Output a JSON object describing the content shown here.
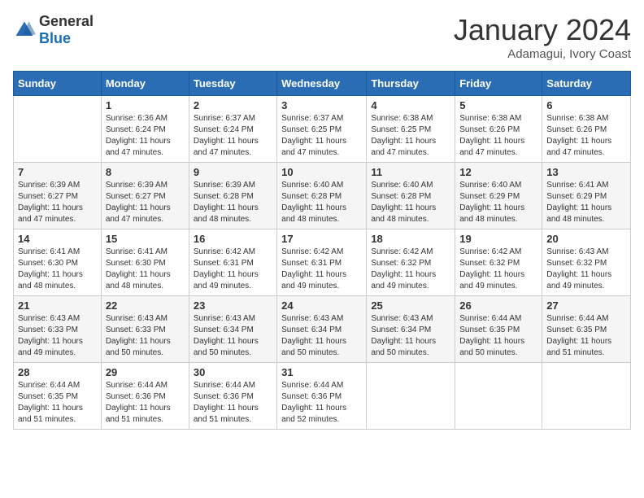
{
  "header": {
    "logo_general": "General",
    "logo_blue": "Blue",
    "month_title": "January 2024",
    "subtitle": "Adamagui, Ivory Coast"
  },
  "weekdays": [
    "Sunday",
    "Monday",
    "Tuesday",
    "Wednesday",
    "Thursday",
    "Friday",
    "Saturday"
  ],
  "weeks": [
    [
      {
        "day": "",
        "info": ""
      },
      {
        "day": "1",
        "info": "Sunrise: 6:36 AM\nSunset: 6:24 PM\nDaylight: 11 hours and 47 minutes."
      },
      {
        "day": "2",
        "info": "Sunrise: 6:37 AM\nSunset: 6:24 PM\nDaylight: 11 hours and 47 minutes."
      },
      {
        "day": "3",
        "info": "Sunrise: 6:37 AM\nSunset: 6:25 PM\nDaylight: 11 hours and 47 minutes."
      },
      {
        "day": "4",
        "info": "Sunrise: 6:38 AM\nSunset: 6:25 PM\nDaylight: 11 hours and 47 minutes."
      },
      {
        "day": "5",
        "info": "Sunrise: 6:38 AM\nSunset: 6:26 PM\nDaylight: 11 hours and 47 minutes."
      },
      {
        "day": "6",
        "info": "Sunrise: 6:38 AM\nSunset: 6:26 PM\nDaylight: 11 hours and 47 minutes."
      }
    ],
    [
      {
        "day": "7",
        "info": "Sunrise: 6:39 AM\nSunset: 6:27 PM\nDaylight: 11 hours and 47 minutes."
      },
      {
        "day": "8",
        "info": "Sunrise: 6:39 AM\nSunset: 6:27 PM\nDaylight: 11 hours and 47 minutes."
      },
      {
        "day": "9",
        "info": "Sunrise: 6:39 AM\nSunset: 6:28 PM\nDaylight: 11 hours and 48 minutes."
      },
      {
        "day": "10",
        "info": "Sunrise: 6:40 AM\nSunset: 6:28 PM\nDaylight: 11 hours and 48 minutes."
      },
      {
        "day": "11",
        "info": "Sunrise: 6:40 AM\nSunset: 6:28 PM\nDaylight: 11 hours and 48 minutes."
      },
      {
        "day": "12",
        "info": "Sunrise: 6:40 AM\nSunset: 6:29 PM\nDaylight: 11 hours and 48 minutes."
      },
      {
        "day": "13",
        "info": "Sunrise: 6:41 AM\nSunset: 6:29 PM\nDaylight: 11 hours and 48 minutes."
      }
    ],
    [
      {
        "day": "14",
        "info": "Sunrise: 6:41 AM\nSunset: 6:30 PM\nDaylight: 11 hours and 48 minutes."
      },
      {
        "day": "15",
        "info": "Sunrise: 6:41 AM\nSunset: 6:30 PM\nDaylight: 11 hours and 48 minutes."
      },
      {
        "day": "16",
        "info": "Sunrise: 6:42 AM\nSunset: 6:31 PM\nDaylight: 11 hours and 49 minutes."
      },
      {
        "day": "17",
        "info": "Sunrise: 6:42 AM\nSunset: 6:31 PM\nDaylight: 11 hours and 49 minutes."
      },
      {
        "day": "18",
        "info": "Sunrise: 6:42 AM\nSunset: 6:32 PM\nDaylight: 11 hours and 49 minutes."
      },
      {
        "day": "19",
        "info": "Sunrise: 6:42 AM\nSunset: 6:32 PM\nDaylight: 11 hours and 49 minutes."
      },
      {
        "day": "20",
        "info": "Sunrise: 6:43 AM\nSunset: 6:32 PM\nDaylight: 11 hours and 49 minutes."
      }
    ],
    [
      {
        "day": "21",
        "info": "Sunrise: 6:43 AM\nSunset: 6:33 PM\nDaylight: 11 hours and 49 minutes."
      },
      {
        "day": "22",
        "info": "Sunrise: 6:43 AM\nSunset: 6:33 PM\nDaylight: 11 hours and 50 minutes."
      },
      {
        "day": "23",
        "info": "Sunrise: 6:43 AM\nSunset: 6:34 PM\nDaylight: 11 hours and 50 minutes."
      },
      {
        "day": "24",
        "info": "Sunrise: 6:43 AM\nSunset: 6:34 PM\nDaylight: 11 hours and 50 minutes."
      },
      {
        "day": "25",
        "info": "Sunrise: 6:43 AM\nSunset: 6:34 PM\nDaylight: 11 hours and 50 minutes."
      },
      {
        "day": "26",
        "info": "Sunrise: 6:44 AM\nSunset: 6:35 PM\nDaylight: 11 hours and 50 minutes."
      },
      {
        "day": "27",
        "info": "Sunrise: 6:44 AM\nSunset: 6:35 PM\nDaylight: 11 hours and 51 minutes."
      }
    ],
    [
      {
        "day": "28",
        "info": "Sunrise: 6:44 AM\nSunset: 6:35 PM\nDaylight: 11 hours and 51 minutes."
      },
      {
        "day": "29",
        "info": "Sunrise: 6:44 AM\nSunset: 6:36 PM\nDaylight: 11 hours and 51 minutes."
      },
      {
        "day": "30",
        "info": "Sunrise: 6:44 AM\nSunset: 6:36 PM\nDaylight: 11 hours and 51 minutes."
      },
      {
        "day": "31",
        "info": "Sunrise: 6:44 AM\nSunset: 6:36 PM\nDaylight: 11 hours and 52 minutes."
      },
      {
        "day": "",
        "info": ""
      },
      {
        "day": "",
        "info": ""
      },
      {
        "day": "",
        "info": ""
      }
    ]
  ]
}
